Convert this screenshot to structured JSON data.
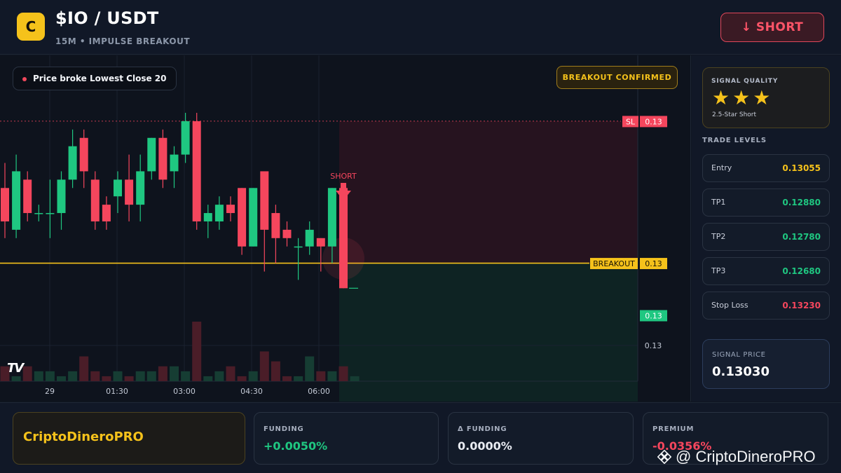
{
  "header": {
    "logo_letter": "C",
    "pair": "$IO / USDT",
    "subtitle": "15M • IMPULSE BREAKOUT",
    "short_label": "↓ SHORT"
  },
  "chart_overlay": {
    "pill_text": "Price broke Lowest Close 20",
    "confirm_text": "BREAKOUT CONFIRMED",
    "short_marker": "SHORT",
    "sl_tag": "SL",
    "sl_value": "0.13",
    "breakout_tag": "BREAKOUT",
    "breakout_value": "0.13",
    "last_value": "0.13",
    "grid_value": "0.13",
    "tv_logo": "TV"
  },
  "chart_data": {
    "type": "candlestick",
    "x_tick_labels": [
      "29",
      "01:30",
      "03:00",
      "04:30",
      "06:00"
    ],
    "price_range": [
      0.1299,
      0.1324
    ],
    "sl_price": 0.1323,
    "breakout_price": 0.1306,
    "entry_price": 0.13055,
    "last_price": 0.1303,
    "grid_price": 0.13003,
    "colors": {
      "up": "#1fc781",
      "down": "#f5465d",
      "breakout": "#f5c21b"
    },
    "candles": [
      {
        "o": 0.1315,
        "h": 0.1318,
        "l": 0.1309,
        "c": 0.1311
      },
      {
        "o": 0.131,
        "h": 0.1319,
        "l": 0.1309,
        "c": 0.1317
      },
      {
        "o": 0.1316,
        "h": 0.1317,
        "l": 0.1311,
        "c": 0.1312
      },
      {
        "o": 0.1312,
        "h": 0.1313,
        "l": 0.1311,
        "c": 0.1312
      },
      {
        "o": 0.1312,
        "h": 0.1316,
        "l": 0.1309,
        "c": 0.1312
      },
      {
        "o": 0.1312,
        "h": 0.1317,
        "l": 0.131,
        "c": 0.1316
      },
      {
        "o": 0.1316,
        "h": 0.1322,
        "l": 0.1315,
        "c": 0.132
      },
      {
        "o": 0.1321,
        "h": 0.1322,
        "l": 0.1315,
        "c": 0.1317
      },
      {
        "o": 0.1316,
        "h": 0.1317,
        "l": 0.131,
        "c": 0.1311
      },
      {
        "o": 0.1313,
        "h": 0.1314,
        "l": 0.131,
        "c": 0.1311
      },
      {
        "o": 0.1314,
        "h": 0.1317,
        "l": 0.1312,
        "c": 0.1316
      },
      {
        "o": 0.1316,
        "h": 0.1319,
        "l": 0.1311,
        "c": 0.1313
      },
      {
        "o": 0.1313,
        "h": 0.1319,
        "l": 0.1311,
        "c": 0.1317
      },
      {
        "o": 0.1317,
        "h": 0.1321,
        "l": 0.1316,
        "c": 0.1321
      },
      {
        "o": 0.1321,
        "h": 0.1322,
        "l": 0.1315,
        "c": 0.1316
      },
      {
        "o": 0.1317,
        "h": 0.132,
        "l": 0.1315,
        "c": 0.1319
      },
      {
        "o": 0.1319,
        "h": 0.1324,
        "l": 0.1318,
        "c": 0.1323
      },
      {
        "o": 0.1323,
        "h": 0.1324,
        "l": 0.131,
        "c": 0.1311
      },
      {
        "o": 0.1311,
        "h": 0.1313,
        "l": 0.1309,
        "c": 0.1312
      },
      {
        "o": 0.1311,
        "h": 0.1314,
        "l": 0.131,
        "c": 0.1313
      },
      {
        "o": 0.1313,
        "h": 0.1314,
        "l": 0.1311,
        "c": 0.1312
      },
      {
        "o": 0.1315,
        "h": 0.1315,
        "l": 0.1307,
        "c": 0.1308
      },
      {
        "o": 0.1308,
        "h": 0.1315,
        "l": 0.1308,
        "c": 0.1315
      },
      {
        "o": 0.1317,
        "h": 0.1317,
        "l": 0.1305,
        "c": 0.131
      },
      {
        "o": 0.1312,
        "h": 0.1313,
        "l": 0.1306,
        "c": 0.1309
      },
      {
        "o": 0.131,
        "h": 0.1311,
        "l": 0.1308,
        "c": 0.1309
      },
      {
        "o": 0.1308,
        "h": 0.1309,
        "l": 0.1304,
        "c": 0.1308
      },
      {
        "o": 0.1308,
        "h": 0.1311,
        "l": 0.1307,
        "c": 0.131
      },
      {
        "o": 0.1309,
        "h": 0.1309,
        "l": 0.1305,
        "c": 0.1308
      },
      {
        "o": 0.1308,
        "h": 0.1315,
        "l": 0.1306,
        "c": 0.1315
      },
      {
        "o": 0.1315,
        "h": 0.1315,
        "l": 0.1303,
        "c": 0.1303
      }
    ],
    "volumes": [
      3,
      1,
      3,
      2,
      2,
      1,
      2,
      5,
      2,
      1,
      2,
      1,
      2,
      2,
      3,
      3,
      2,
      12,
      1,
      2,
      3,
      1,
      2,
      6,
      4,
      1,
      1,
      5,
      2,
      2,
      3,
      1
    ]
  },
  "panel": {
    "quality_title": "SIGNAL QUALITY",
    "stars": "★★★",
    "quality_sub": "2.5-Star Short",
    "levels_title": "TRADE LEVELS",
    "levels": [
      {
        "name": "Entry",
        "value": "0.13055",
        "color": "#f5c21b"
      },
      {
        "name": "TP1",
        "value": "0.12880",
        "color": "#1fc781"
      },
      {
        "name": "TP2",
        "value": "0.12780",
        "color": "#1fc781"
      },
      {
        "name": "TP3",
        "value": "0.12680",
        "color": "#1fc781"
      },
      {
        "name": "Stop Loss",
        "value": "0.13230",
        "color": "#f5465d"
      }
    ],
    "signal_price_label": "SIGNAL PRICE",
    "signal_price": "0.13030"
  },
  "footer": {
    "brand": "CriptoDineroPRO",
    "funding_label": "FUNDING",
    "funding_value": "+0.0050%",
    "dfunding_label": "Δ FUNDING",
    "dfunding_value": "0.0000%",
    "premium_label": "PREMIUM",
    "premium_value": "-0.0356%",
    "watermark": "@ CriptoDineroPRO"
  }
}
